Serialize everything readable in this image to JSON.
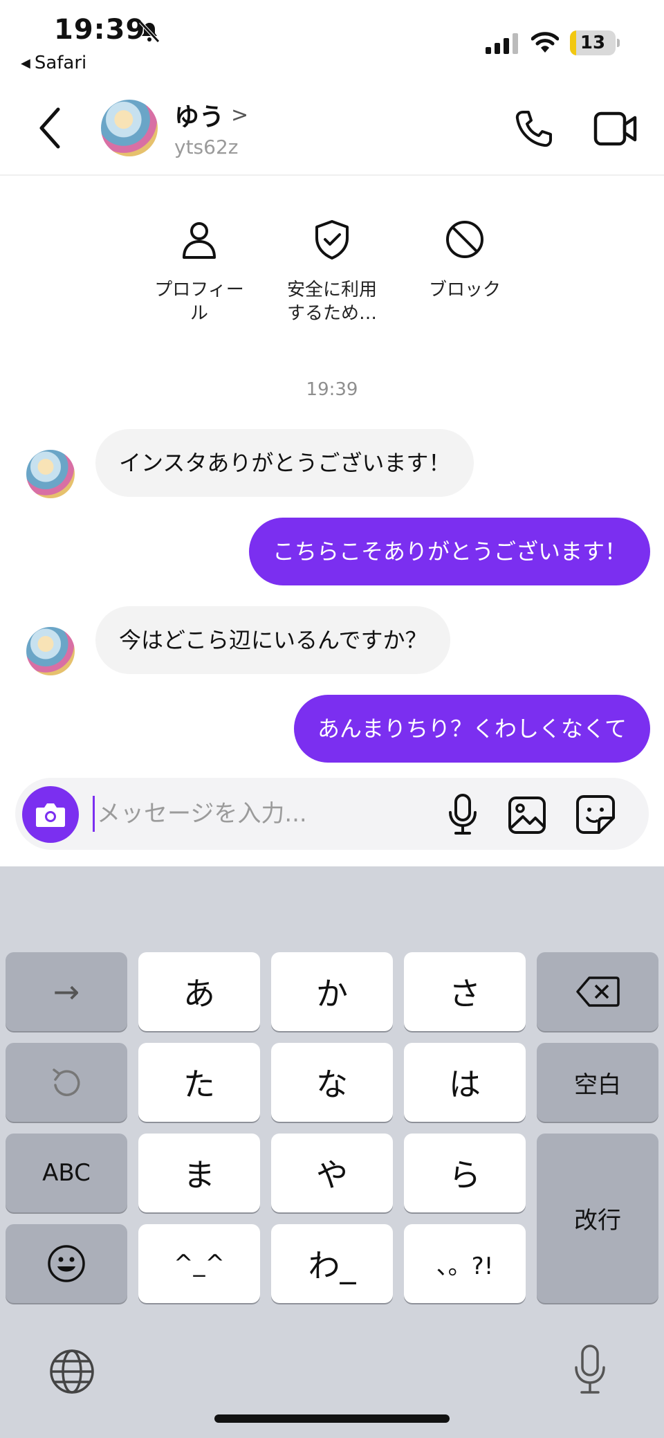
{
  "status": {
    "time": "19:39",
    "back_app": "Safari",
    "battery": "13",
    "battery_level": 0.13
  },
  "header": {
    "name": "ゆう",
    "username": "yts62z"
  },
  "actions": [
    {
      "label": "プロフィール",
      "line1": "プロフィー",
      "line2": "ル"
    },
    {
      "label": "安全に利用するため…",
      "line1": "安全に利用",
      "line2": "するため…"
    },
    {
      "label": "ブロック",
      "line1": "ブロック",
      "line2": ""
    }
  ],
  "chat_time": "19:39",
  "messages": [
    {
      "side": "in",
      "text": "インスタありがとうございます！"
    },
    {
      "side": "out",
      "text": "こちらこそありがとうございます！"
    },
    {
      "side": "in",
      "text": "今はどこら辺にいるんですか？"
    },
    {
      "side": "out",
      "text": "あんまりちり？くわしくなくて"
    }
  ],
  "composer": {
    "placeholder": "メッセージを入力..."
  },
  "keyboard": {
    "row1": [
      "→",
      "あ",
      "か",
      "さ",
      "⌫"
    ],
    "row2": [
      "↺",
      "た",
      "な",
      "は",
      "空白"
    ],
    "row3": [
      "ABC",
      "ま",
      "や",
      "ら"
    ],
    "row4": [
      "😊",
      "^_^",
      "わ_",
      "、。?!"
    ],
    "enter": "改行"
  },
  "colors": {
    "accent": "#7b2ff0",
    "incoming_bubble": "#f3f3f3",
    "keyboard_bg": "#d1d4db"
  }
}
